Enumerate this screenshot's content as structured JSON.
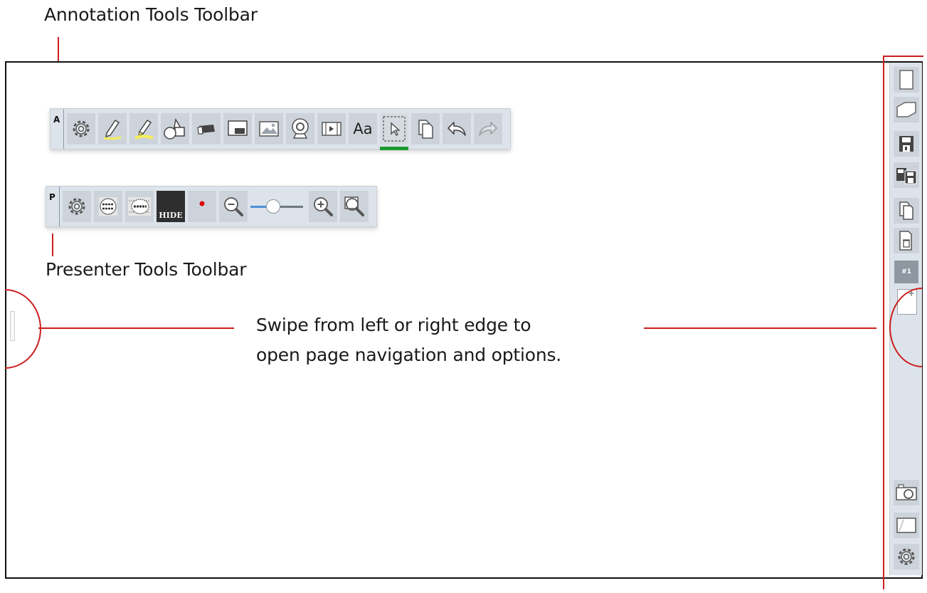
{
  "callouts": {
    "annotation_label": "Annotation Tools Toolbar",
    "presenter_label": "Presenter Tools Toolbar",
    "swipe_line1": "Swipe from left or right edge to",
    "swipe_line2": "open page navigation and options."
  },
  "annotation_toolbar": {
    "letter": "A",
    "tools": [
      {
        "name": "settings",
        "icon": "gear-icon"
      },
      {
        "name": "pen",
        "icon": "pen-icon"
      },
      {
        "name": "highlighter",
        "icon": "highlighter-icon"
      },
      {
        "name": "shapes",
        "icon": "shapes-icon"
      },
      {
        "name": "eraser",
        "icon": "eraser-icon"
      },
      {
        "name": "clear",
        "icon": "whiteboard-eraser-icon"
      },
      {
        "name": "image",
        "icon": "image-icon"
      },
      {
        "name": "camera",
        "icon": "webcam-icon"
      },
      {
        "name": "video",
        "icon": "video-icon"
      },
      {
        "name": "text",
        "icon": "text-icon",
        "label": "Aa"
      },
      {
        "name": "select",
        "icon": "select-arrow-icon",
        "active": true
      },
      {
        "name": "paste",
        "icon": "paste-icon"
      },
      {
        "name": "undo",
        "icon": "undo-icon"
      },
      {
        "name": "redo",
        "icon": "redo-icon",
        "disabled": true
      }
    ]
  },
  "presenter_toolbar": {
    "letter": "P",
    "hide_label": "HIDE",
    "zoom_level": 0.3
  },
  "sidebar": {
    "page_number": "#1",
    "thumb_mark": "+"
  },
  "colors": {
    "toolbar_bg": "#dde3ea",
    "button_bg": "#cdd3da",
    "active_underline": "#1b9a31",
    "callout_red": "#cc1f1f",
    "record_dot": "#e00000",
    "slider_fill": "#4d8fd6"
  }
}
